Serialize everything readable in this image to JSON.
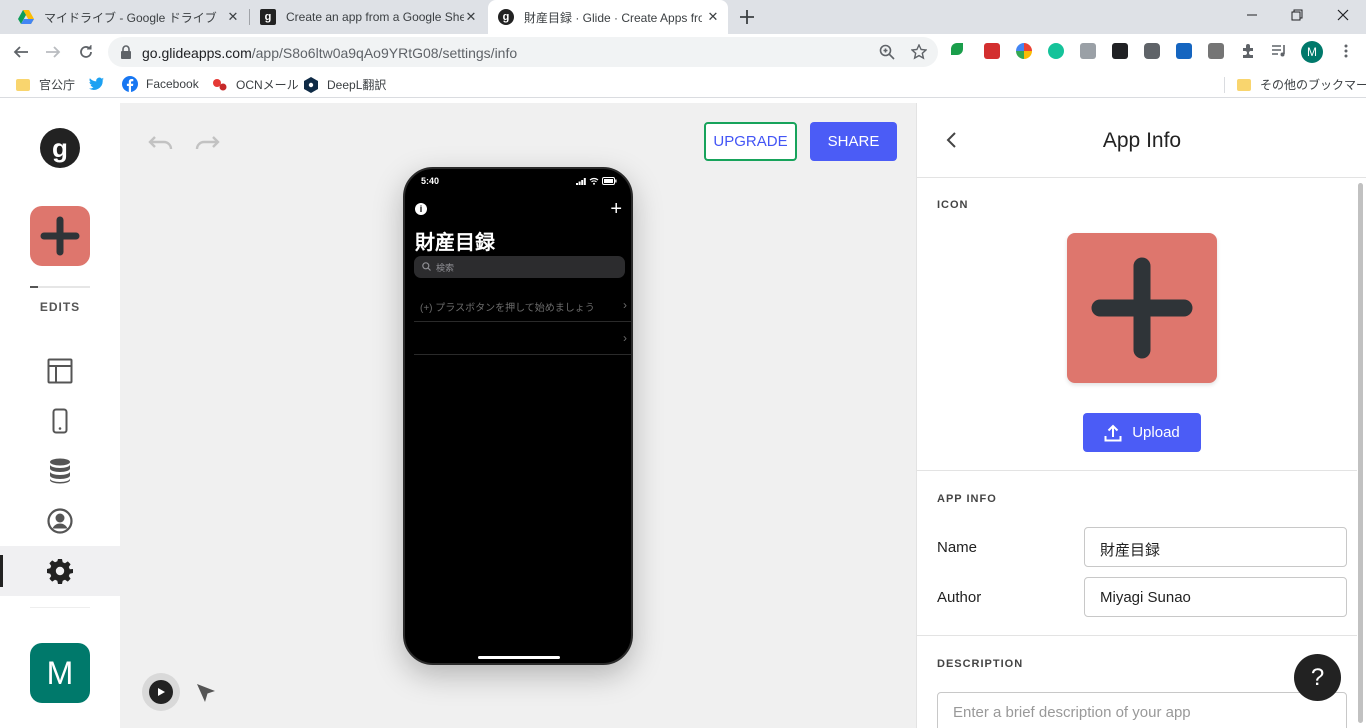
{
  "browser": {
    "tabs": [
      {
        "title": "マイドライブ - Google ドライブ",
        "icon": "google-drive-icon"
      },
      {
        "title": "Create an app from a Google Sheet",
        "icon": "glide-icon"
      },
      {
        "title": "財産目録 · Glide · Create Apps from",
        "icon": "glide-icon"
      }
    ],
    "url_host": "go.glideapps.com",
    "url_path": "/app/S8o6ltw0a9qAo9YRtG08/settings/info",
    "profile_initial": "M"
  },
  "bookmarks": [
    {
      "label": "官公庁",
      "icon": "folder-icon"
    },
    {
      "label": "",
      "icon": "twitter-icon"
    },
    {
      "label": "Facebook",
      "icon": "facebook-icon"
    },
    {
      "label": "OCNメール",
      "icon": "ocn-icon"
    },
    {
      "label": "DeepL翻訳",
      "icon": "deepl-icon"
    }
  ],
  "bookmarks_other": "その他のブックマーク",
  "rail": {
    "logo": "g",
    "edits_label": "EDITS",
    "user_initial": "M"
  },
  "toolbar": {
    "upgrade_label": "UPGRADE",
    "share_label": "SHARE"
  },
  "phone": {
    "time": "5:40",
    "title": "財産目録",
    "search_placeholder": "検索",
    "rows": [
      "(+) プラスボタンを押して始めましょう",
      ""
    ]
  },
  "panel": {
    "title": "App Info",
    "icon_section": "ICON",
    "upload_label": "Upload",
    "app_info_section": "APP INFO",
    "name_label": "Name",
    "name_value": "財産目録",
    "author_label": "Author",
    "author_value": "Miyagi Sunao",
    "description_section": "DESCRIPTION",
    "description_placeholder": "Enter a brief description of your app",
    "help_label": "?"
  },
  "colors": {
    "accent": "#4b5cf6",
    "upgrade_border": "#17a35b",
    "app_icon": "#de766d",
    "user_tile": "#00796b"
  }
}
